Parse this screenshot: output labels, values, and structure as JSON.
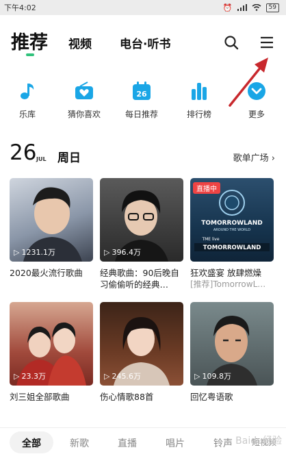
{
  "status": {
    "time": "下午4:02",
    "battery": "59"
  },
  "nav": {
    "tabs": [
      "推荐",
      "视频",
      "电台·听书"
    ],
    "icons": [
      "search-icon",
      "menu-icon"
    ]
  },
  "quick": [
    {
      "label": "乐库",
      "icon": "music-note-icon"
    },
    {
      "label": "猜你喜欢",
      "icon": "radio-heart-icon"
    },
    {
      "label": "每日推荐",
      "icon": "calendar-icon",
      "day": "26"
    },
    {
      "label": "排行榜",
      "icon": "chart-icon"
    },
    {
      "label": "更多",
      "icon": "chevron-down-icon"
    }
  ],
  "date": {
    "day": "26",
    "month": "JUL",
    "weekday": "周日",
    "more": "歌单广场"
  },
  "cards": [
    {
      "title": "2020最火流行歌曲",
      "subtitle": "",
      "plays": "1231.1万"
    },
    {
      "title": "经典歌曲：90后晚自习偷偷听的经典…",
      "subtitle": "",
      "plays": "396.4万"
    },
    {
      "title": "狂欢盛宴 放肆燃燥",
      "subtitle": "[推荐]TomorrowL…",
      "plays": "",
      "badge": "直播中",
      "poster": {
        "line1": "TOMORROWLAND",
        "line2": "AROUND THE WORLD",
        "line3": "TME live",
        "line4": "TOMORROWLAND"
      }
    },
    {
      "title": "刘三姐全部歌曲",
      "subtitle": "",
      "plays": "23.3万"
    },
    {
      "title": "伤心情歌88首",
      "subtitle": "",
      "plays": "245.6万"
    },
    {
      "title": "回忆粤语歌",
      "subtitle": "",
      "plays": "109.8万"
    }
  ],
  "bottom_tabs": [
    "全部",
    "新歌",
    "直播",
    "唱片",
    "铃声",
    "短视频"
  ],
  "watermark": "Baidu经验",
  "colors": {
    "accent": "#31c27c",
    "icon_blue": "#1aa6e6",
    "arrow": "#c8282d"
  }
}
